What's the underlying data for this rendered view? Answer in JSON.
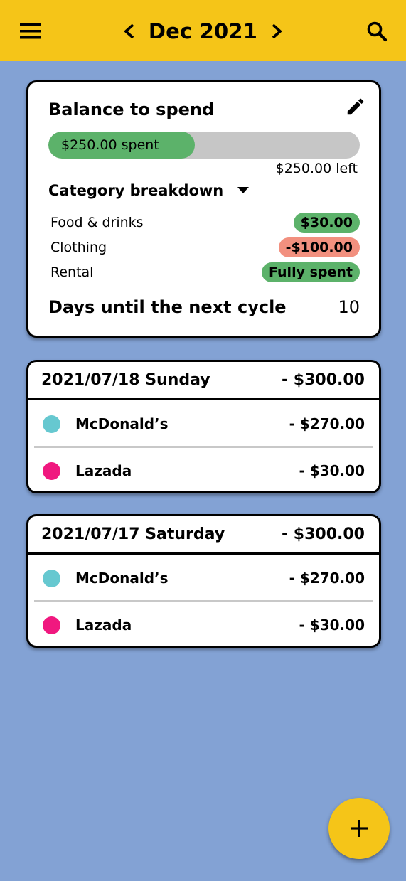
{
  "appbar": {
    "title": "Dec 2021",
    "menu_icon": "menu-icon",
    "search_icon": "search-icon",
    "prev_icon": "chevron-left-icon",
    "next_icon": "chevron-right-icon",
    "background": "#F5C518"
  },
  "balance": {
    "title": "Balance to spend",
    "edit_icon": "pencil-icon",
    "spent_label": "$250.00 spent",
    "left_label": "$250.00 left",
    "spent_fraction": 0.47,
    "category_header": "Category breakdown",
    "categories": [
      {
        "name": "Food & drinks",
        "amount": "$30.00",
        "status": "green"
      },
      {
        "name": "Clothing",
        "amount": "-$100.00",
        "status": "red"
      },
      {
        "name": "Rental",
        "amount": "Fully spent",
        "status": "green"
      }
    ],
    "days_label": "Days until the next cycle",
    "days_value": "10"
  },
  "days": [
    {
      "date": "2021/07/18 Sunday",
      "total": "- $300.00",
      "transactions": [
        {
          "name": "McDonald’s",
          "amount": "- $270.00",
          "color": "#66C8D0"
        },
        {
          "name": "Lazada",
          "amount": "- $30.00",
          "color": "#F0187F"
        }
      ]
    },
    {
      "date": "2021/07/17 Saturday",
      "total": "- $300.00",
      "transactions": [
        {
          "name": "McDonald’s",
          "amount": "- $270.00",
          "color": "#66C8D0"
        },
        {
          "name": "Lazada",
          "amount": "- $30.00",
          "color": "#F0187F"
        }
      ]
    }
  ],
  "fab": {
    "icon": "plus-icon"
  },
  "colors": {
    "background": "#83A2D4",
    "green": "#5CB26A",
    "red": "#F2907F",
    "track": "#C6C6C6"
  }
}
